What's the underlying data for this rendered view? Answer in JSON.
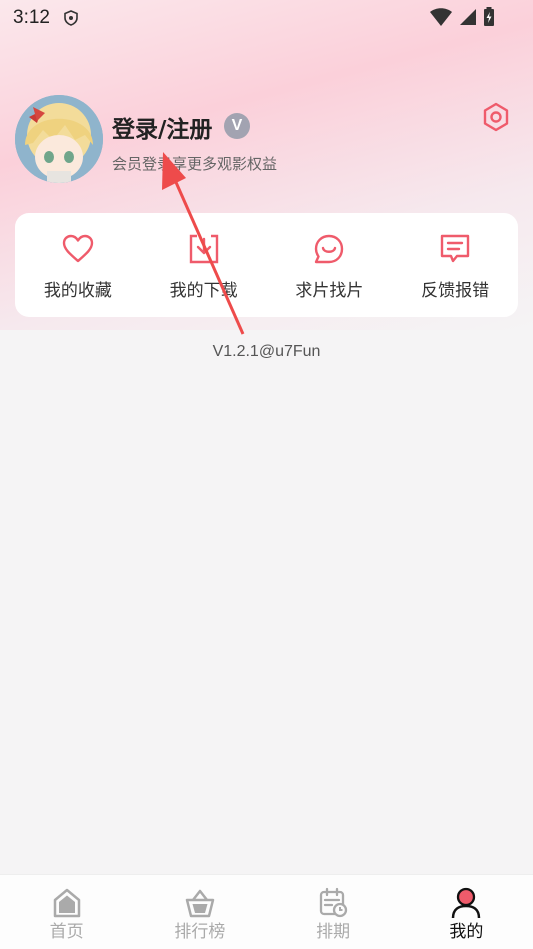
{
  "status_bar": {
    "time": "3:12"
  },
  "profile": {
    "title": "登录/注册",
    "vip_badge": "V",
    "subtitle": "会员登录享更多观影权益"
  },
  "quick_actions": [
    {
      "label": "我的收藏",
      "icon": "heart-icon"
    },
    {
      "label": "我的下载",
      "icon": "download-icon"
    },
    {
      "label": "求片找片",
      "icon": "smile-chat-icon"
    },
    {
      "label": "反馈报错",
      "icon": "feedback-icon"
    }
  ],
  "version": "V1.2.1@u7Fun",
  "bottom_nav": [
    {
      "label": "首页",
      "icon": "home-icon",
      "active": false
    },
    {
      "label": "排行榜",
      "icon": "basket-icon",
      "active": false
    },
    {
      "label": "排期",
      "icon": "calendar-icon",
      "active": false
    },
    {
      "label": "我的",
      "icon": "user-icon",
      "active": true
    }
  ],
  "colors": {
    "accent": "#ef5b6b",
    "background": "#f5f4f5",
    "badge": "#a2a3b1"
  }
}
